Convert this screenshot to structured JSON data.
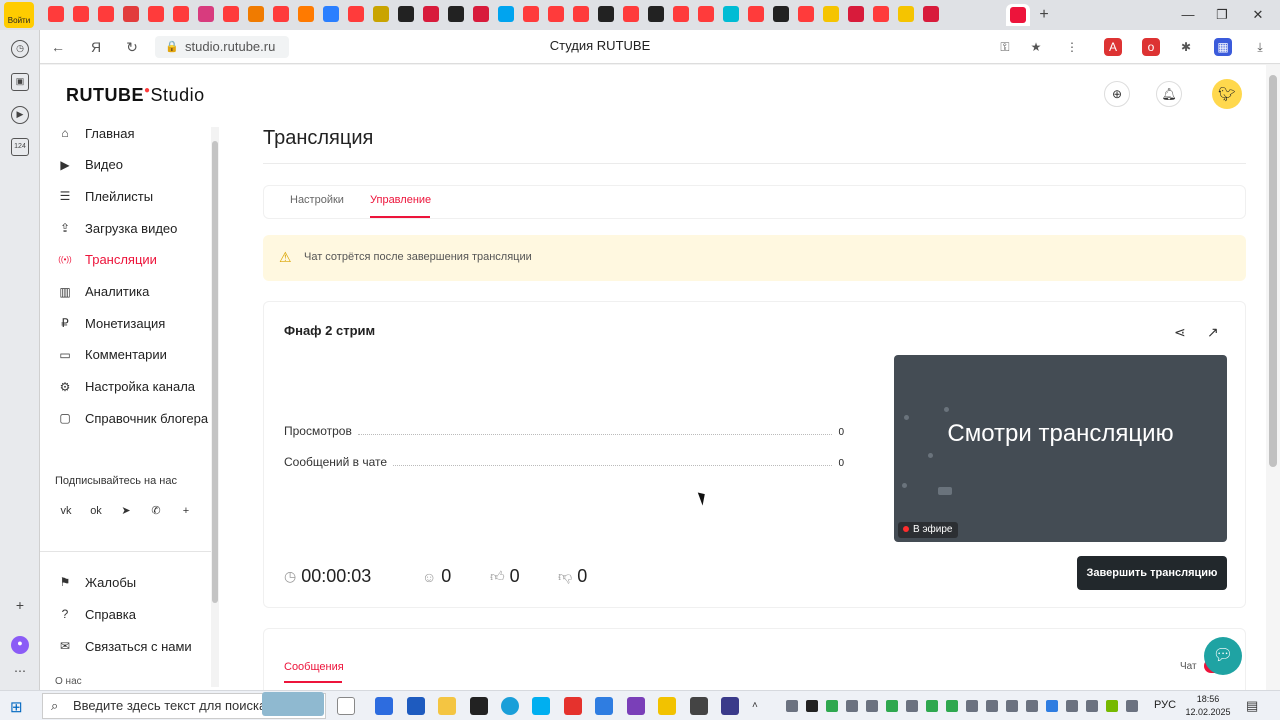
{
  "browser": {
    "profile_label": "Войти",
    "url": "studio.rutube.ru",
    "page_title": "Студия RUTUBE",
    "new_tab_symbol": "+",
    "window_buttons": [
      "—",
      "❐",
      "✕"
    ],
    "tab_favicon_colors": [
      "#ff3b3b",
      "#ff3b3b",
      "#ff3b3b",
      "#e23c3c",
      "#ff3b3b",
      "#ff3b3b",
      "#d83b7e",
      "#ff3b3b",
      "#f07b00",
      "#ff3b3b",
      "#ff7a00",
      "#2a7fff",
      "#ff3b3b",
      "#c9a400",
      "#222222",
      "#d81b3b",
      "#222222",
      "#d81b3b",
      "#00a4ef",
      "#ff3b3b",
      "#ff3b3b",
      "#ff3b3b",
      "#222222",
      "#ff3b3b",
      "#222222",
      "#ff3b3b",
      "#ff3b3b",
      "#00bcd4",
      "#ff3b3b",
      "#222222",
      "#ff3b3b",
      "#f5c400",
      "#d81b3b",
      "#ff3b3b",
      "#f5c400",
      "#d81b3b"
    ]
  },
  "sidestrip": {
    "badge": "124"
  },
  "app": {
    "logo": "RUTUBE",
    "logo_suffix": "Studio",
    "header_icons": [
      "add-video-icon",
      "bell-icon"
    ]
  },
  "sidebar": {
    "items": [
      {
        "label": "Главная",
        "icon": "home-icon",
        "active": false
      },
      {
        "label": "Видео",
        "icon": "play-icon",
        "active": false
      },
      {
        "label": "Плейлисты",
        "icon": "list-icon",
        "active": false
      },
      {
        "label": "Загрузка видео",
        "icon": "upload-icon",
        "active": false
      },
      {
        "label": "Трансляции",
        "icon": "broadcast-icon",
        "active": true
      },
      {
        "label": "Аналитика",
        "icon": "chart-icon",
        "active": false
      },
      {
        "label": "Монетизация",
        "icon": "ruble-icon",
        "active": false
      },
      {
        "label": "Комментарии",
        "icon": "comment-icon",
        "active": false
      },
      {
        "label": "Настройка канала",
        "icon": "gear-icon",
        "active": false
      },
      {
        "label": "Справочник блогера",
        "icon": "book-icon",
        "active": false
      }
    ],
    "subscribe_label": "Подписывайтесь на нас",
    "socials": [
      "vk",
      "ok",
      "telegram",
      "viber",
      "+"
    ],
    "bottom_items": [
      {
        "label": "Жалобы",
        "icon": "flag-icon"
      },
      {
        "label": "Справка",
        "icon": "help-icon"
      },
      {
        "label": "Связаться с нами",
        "icon": "mail-icon"
      }
    ],
    "about_label": "О нас"
  },
  "main": {
    "title": "Трансляция",
    "tabs": [
      {
        "label": "Настройки",
        "active": false
      },
      {
        "label": "Управление",
        "active": true
      }
    ],
    "warning": "Чат сотрётся после завершения трансляции",
    "stream": {
      "name": "Фнаф 2 стрим",
      "stats": [
        {
          "label": "Просмотров",
          "value": "0"
        },
        {
          "label": "Сообщений в чате",
          "value": "0"
        }
      ],
      "preview_text": "Смотри трансляцию",
      "live_badge": "В эфире",
      "duration": "00:00:03",
      "viewers": "0",
      "likes": "0",
      "dislikes": "0",
      "end_button": "Завершить трансляцию"
    },
    "messages_label": "Сообщения",
    "chat_label": "Чат"
  },
  "taskbar": {
    "search_placeholder": "Введите здесь текст для поиска",
    "lang": "РУС",
    "time": "18:56",
    "date": "12.02.2025"
  }
}
